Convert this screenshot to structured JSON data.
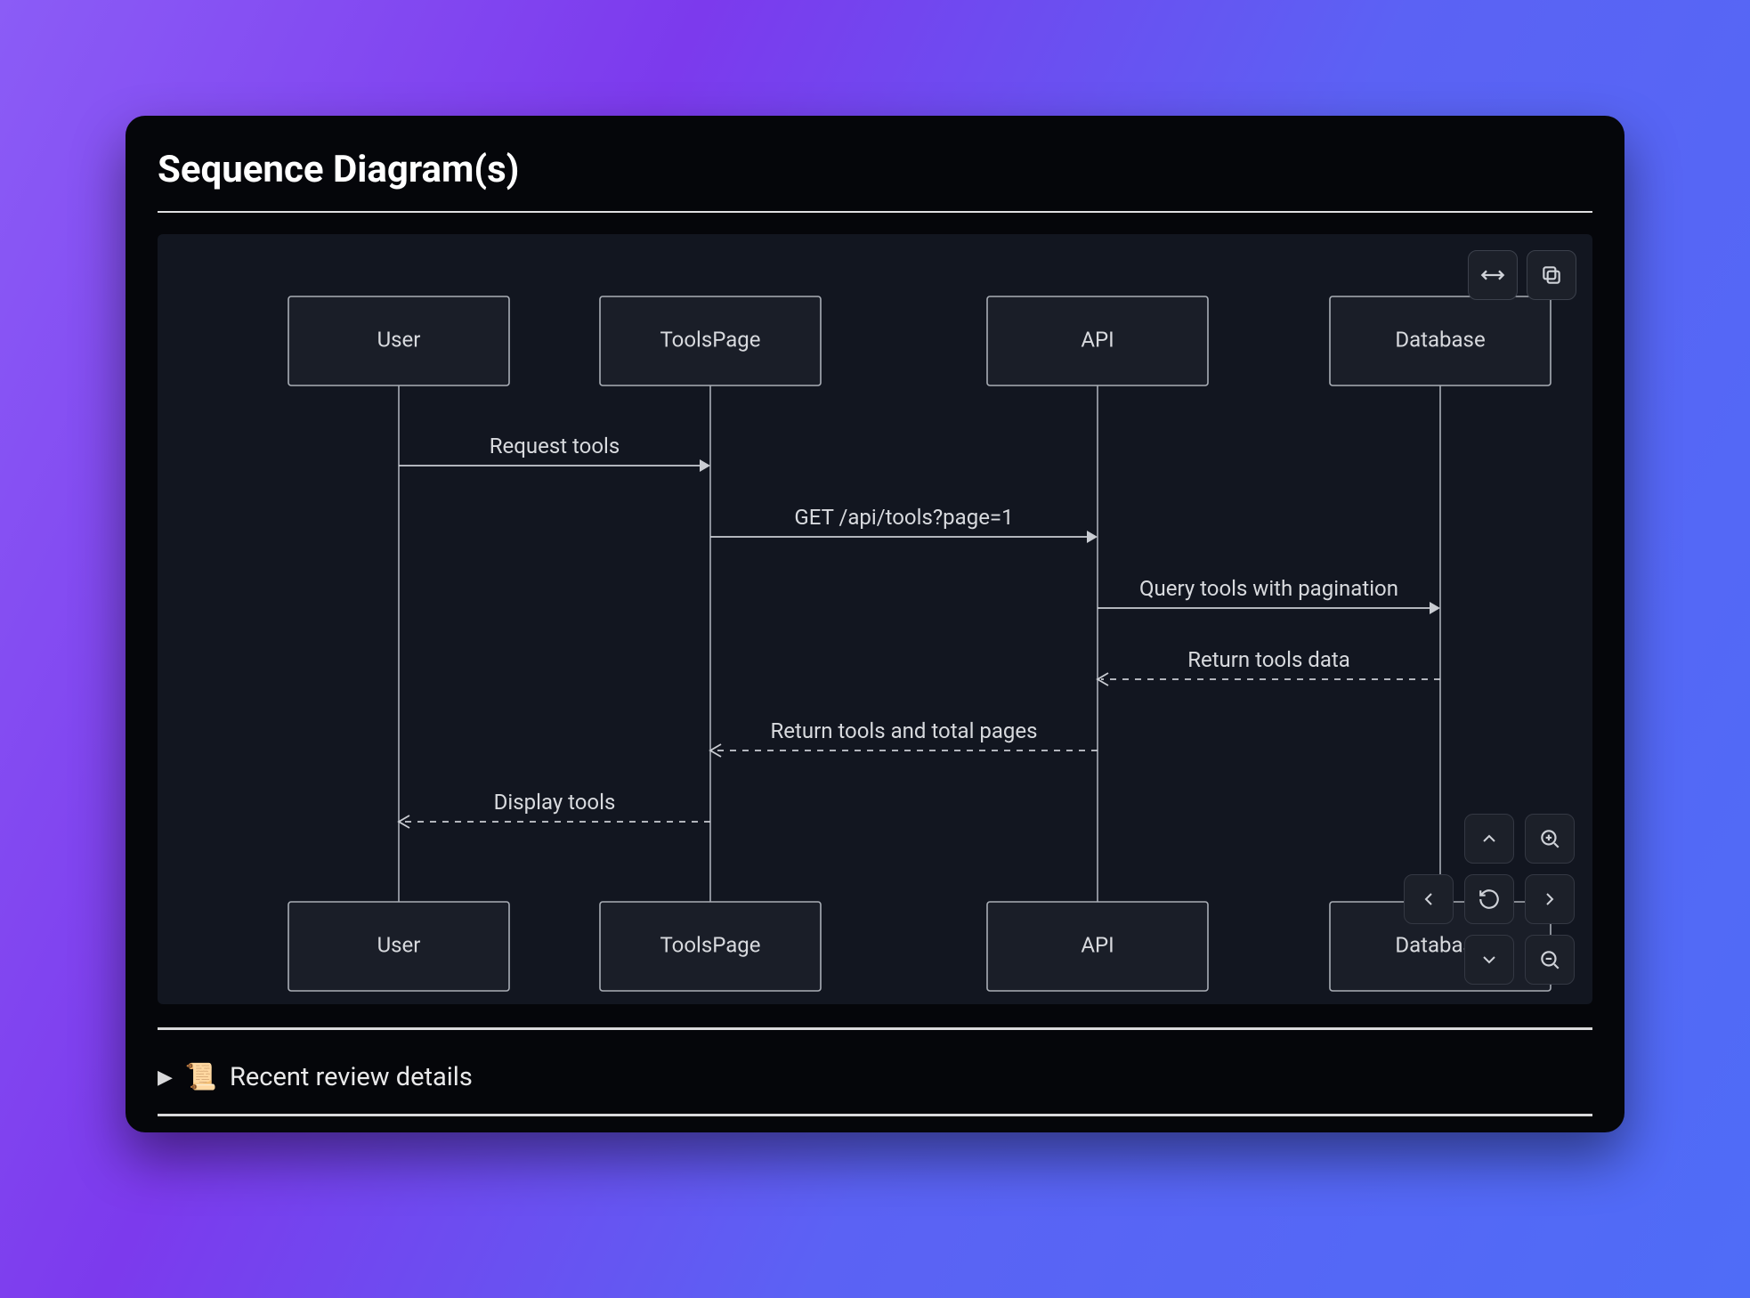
{
  "panel": {
    "title": "Sequence Diagram(s)"
  },
  "details": {
    "icon": "📜",
    "label": "Recent review details"
  },
  "diagram": {
    "participants": [
      "User",
      "ToolsPage",
      "API",
      "Database"
    ],
    "messages": [
      {
        "from": 0,
        "to": 1,
        "label": "Request tools",
        "dashed": false
      },
      {
        "from": 1,
        "to": 2,
        "label": "GET /api/tools?page=1",
        "dashed": false
      },
      {
        "from": 2,
        "to": 3,
        "label": "Query tools with pagination",
        "dashed": false
      },
      {
        "from": 3,
        "to": 2,
        "label": "Return tools data",
        "dashed": true
      },
      {
        "from": 2,
        "to": 1,
        "label": "Return tools and total pages",
        "dashed": true
      },
      {
        "from": 1,
        "to": 0,
        "label": "Display tools",
        "dashed": true
      }
    ]
  },
  "colors": {
    "panel_bg": "#05060a",
    "diagram_bg": "#121620",
    "box_fill": "#1a1e28",
    "stroke": "#a9aeb6",
    "text": "#d8dade"
  }
}
